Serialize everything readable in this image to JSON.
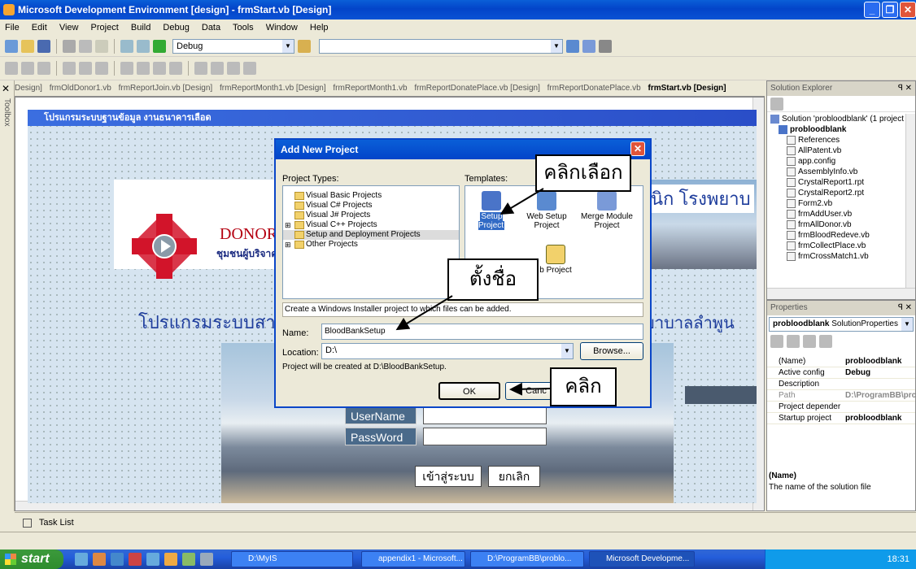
{
  "window": {
    "title": "Microsoft Development Environment [design] - frmStart.vb [Design]"
  },
  "menu": [
    "File",
    "Edit",
    "View",
    "Project",
    "Build",
    "Debug",
    "Data",
    "Tools",
    "Window",
    "Help"
  ],
  "toolbar": {
    "config": "Debug"
  },
  "tabs": [
    "Design]",
    "frmOldDonor1.vb",
    "frmReportJoin.vb [Design]",
    "frmReportMonth1.vb [Design]",
    "frmReportMonth1.vb",
    "frmReportDonatePlace.vb [Design]",
    "frmReportDonatePlace.vb",
    "frmStart.vb [Design]"
  ],
  "toolbox": {
    "label": "Toolbox"
  },
  "form": {
    "title": "โปรแกรมระบบฐานข้อมูล งานธนาคารเลือด",
    "donor": "DONOR",
    "community": "ชุมชนผู้บริจาค",
    "program_line_left": "โปรแกรมระบบสาร",
    "program_line_right": "พยาบาลลำพูน",
    "heading_right": "นิก โรงพยาบ",
    "username": "UserName",
    "password": "PassWord",
    "login": "เข้าสู่ระบบ",
    "cancel": "ยกเลิก"
  },
  "dialog": {
    "title": "Add New Project",
    "project_types_label": "Project Types:",
    "templates_label": "Templates:",
    "project_types": [
      "Visual Basic Projects",
      "Visual C# Projects",
      "Visual J# Projects",
      "Visual C++ Projects",
      "Setup and Deployment Projects",
      "Other Projects"
    ],
    "templates": [
      "Setup Project",
      "Web Setup Project",
      "Merge Module Project",
      "b Project"
    ],
    "description": "Create a Windows Installer project to which files can be added.",
    "name_label": "Name:",
    "name_value": "BloodBankSetup",
    "location_label": "Location:",
    "location_value": "D:\\",
    "browse": "Browse...",
    "created_at": "Project will be created at D:\\BloodBankSetup.",
    "ok": "OK",
    "cancel": "Canc"
  },
  "callouts": {
    "select": "คลิกเลือก",
    "name": "ตั้งชื่อ",
    "click": "คลิก"
  },
  "solution_explorer": {
    "title": "Solution Explorer",
    "solution": "Solution 'probloodblank' (1 project",
    "project": "probloodblank",
    "items": [
      "References",
      "AllPatent.vb",
      "app.config",
      "AssemblyInfo.vb",
      "CrystalReport1.rpt",
      "CrystalReport2.rpt",
      "Form2.vb",
      "frmAddUser.vb",
      "frmAllDonor.vb",
      "frmBloodRedeve.vb",
      "frmCollectPlace.vb",
      "frmCrossMatch1.vb"
    ]
  },
  "properties": {
    "title": "Properties",
    "object": "probloodblank",
    "object_type": "SolutionProperties",
    "rows": [
      {
        "k": "(Name)",
        "v": "probloodblank"
      },
      {
        "k": "Active config",
        "v": "Debug"
      },
      {
        "k": "Description",
        "v": ""
      },
      {
        "k": "Path",
        "v": "D:\\ProgramBB\\prc"
      },
      {
        "k": "Project depender",
        "v": ""
      },
      {
        "k": "Startup project",
        "v": "probloodblank"
      }
    ],
    "help_title": "(Name)",
    "help_text": "The name of the solution file"
  },
  "tasklist": "Task List",
  "taskbar": {
    "start": "start",
    "tasks": [
      "D:\\MyIS",
      "appendix1 - Microsoft...",
      "D:\\ProgramBB\\problo...",
      "Microsoft Developme..."
    ],
    "clock": "18:31"
  }
}
